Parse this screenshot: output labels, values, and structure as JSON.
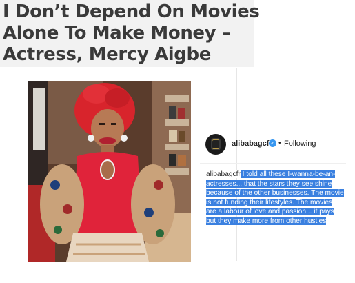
{
  "article": {
    "title_line1": "I Don’t Depend On Movies",
    "title_line2": "Alone To Make Money –",
    "title_line3": "Actress, Mercy Aigbe"
  },
  "post": {
    "username": "alibabagcfr",
    "verified_icon": "verified-badge-icon",
    "separator": "•",
    "follow_status": "Following",
    "caption_user": "alibabagcfr",
    "caption_lines": [
      " I told all these I-wanna-be-an-",
      "actresses... that the stars they see shine",
      "because of the other businesses. The movie",
      "is not funding their lifestyles. The movies",
      "are a labour of love and passion... it pays",
      "but they make more from other hustles"
    ],
    "highlight_color": "#3a80e0"
  }
}
